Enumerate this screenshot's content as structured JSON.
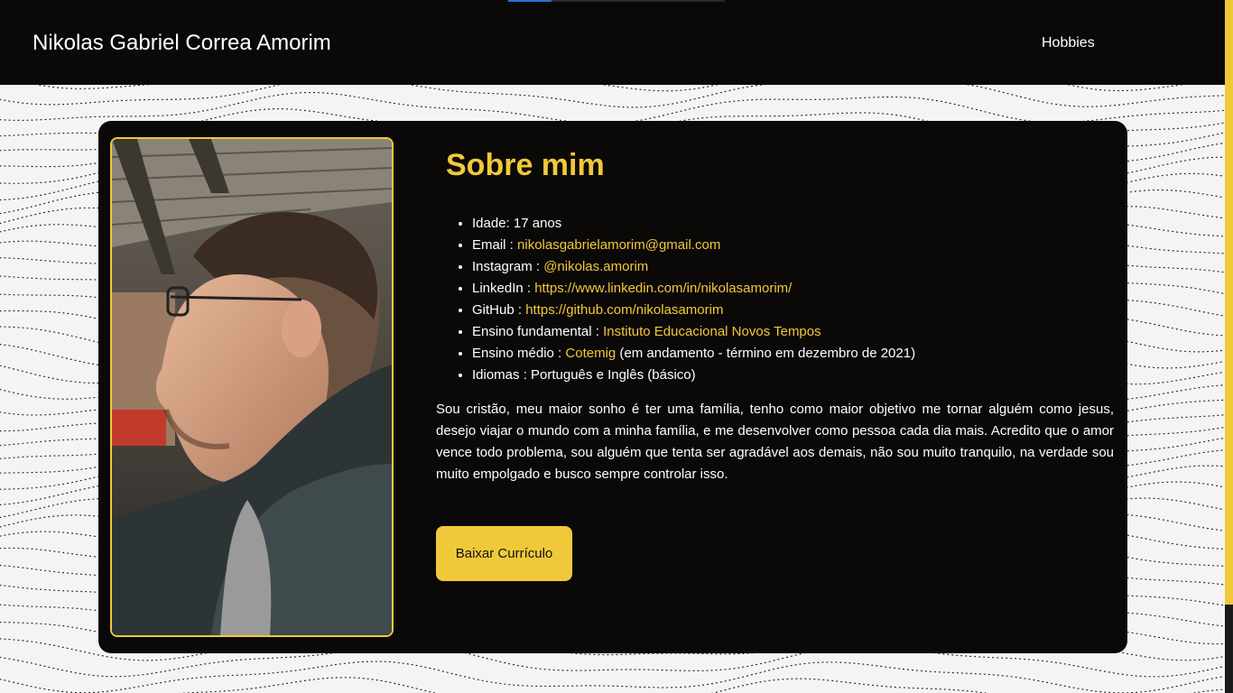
{
  "header": {
    "title": "Nikolas Gabriel Correa Amorim",
    "nav": [
      {
        "label": "Hobbies"
      }
    ],
    "load_progress": 0.2
  },
  "about": {
    "heading": "Sobre mim",
    "photo_alt": "profile-photo",
    "info": [
      {
        "label": "Idade: 17 anos",
        "value": "",
        "suffix": ""
      },
      {
        "label": "Email : ",
        "value": "nikolasgabrielamorim@gmail.com",
        "suffix": ""
      },
      {
        "label": "Instagram : ",
        "value": "@nikolas.amorim",
        "suffix": ""
      },
      {
        "label": "LinkedIn : ",
        "value": "https://www.linkedin.com/in/nikolasamorim/",
        "suffix": ""
      },
      {
        "label": "GitHub : ",
        "value": "https://github.com/nikolasamorim",
        "suffix": ""
      },
      {
        "label": "Ensino fundamental : ",
        "value": "Instituto Educacional Novos Tempos",
        "suffix": ""
      },
      {
        "label": "Ensino médio : ",
        "value": "Cotemig",
        "suffix": " (em andamento - término em dezembro de 2021)"
      },
      {
        "label": "Idiomas : Português e Inglês (básico)",
        "value": "",
        "suffix": ""
      }
    ],
    "bio": "Sou cristão, meu maior sonho é ter uma família, tenho como maior objetivo me tornar alguém como jesus, desejo viajar o mundo com a minha família, e me desenvolver como pessoa cada dia mais. Acredito que o amor vence todo problema, sou alguém que tenta ser agradável aos demais, não sou muito tranquilo, na verdade sou muito empolgado e busco sempre controlar isso.",
    "button_label": "Baixar Currículo"
  },
  "colors": {
    "accent": "#f0c93a",
    "header_bg": "#0b0908",
    "card_bg": "#0b0808",
    "page_bg": "#f4f4f4"
  }
}
